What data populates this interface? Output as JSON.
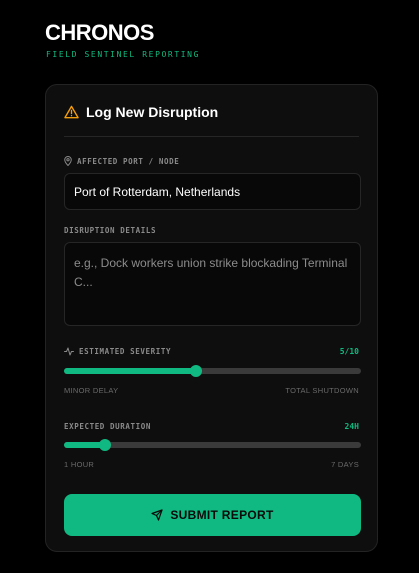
{
  "brand": {
    "title": "CHRONOS",
    "subtitle": "FIELD SENTINEL REPORTING"
  },
  "colors": {
    "accent": "#10b981",
    "warning_icon": "#f59e0b",
    "background": "#000000",
    "card": "#0e0e0e"
  },
  "form": {
    "title": "Log New Disruption",
    "title_icon": "warning-triangle-icon",
    "port": {
      "label": "AFFECTED PORT / NODE",
      "icon": "map-pin-icon",
      "value": "Port of Rotterdam, Netherlands"
    },
    "details": {
      "label": "DISRUPTION DETAILS",
      "value": "",
      "placeholder": "e.g., Dock workers union strike blockading Terminal C..."
    },
    "severity": {
      "label": "ESTIMATED SEVERITY",
      "icon": "activity-icon",
      "value_text": "5/10",
      "value": 5,
      "min": 1,
      "max": 10,
      "min_label": "MINOR DELAY",
      "max_label": "TOTAL SHUTDOWN"
    },
    "duration": {
      "label": "EXPECTED DURATION",
      "value_text": "24H",
      "value": 24,
      "min": 1,
      "max": 168,
      "min_label": "1 HOUR",
      "max_label": "7 DAYS"
    },
    "submit_label": "SUBMIT REPORT",
    "submit_icon": "send-icon"
  }
}
